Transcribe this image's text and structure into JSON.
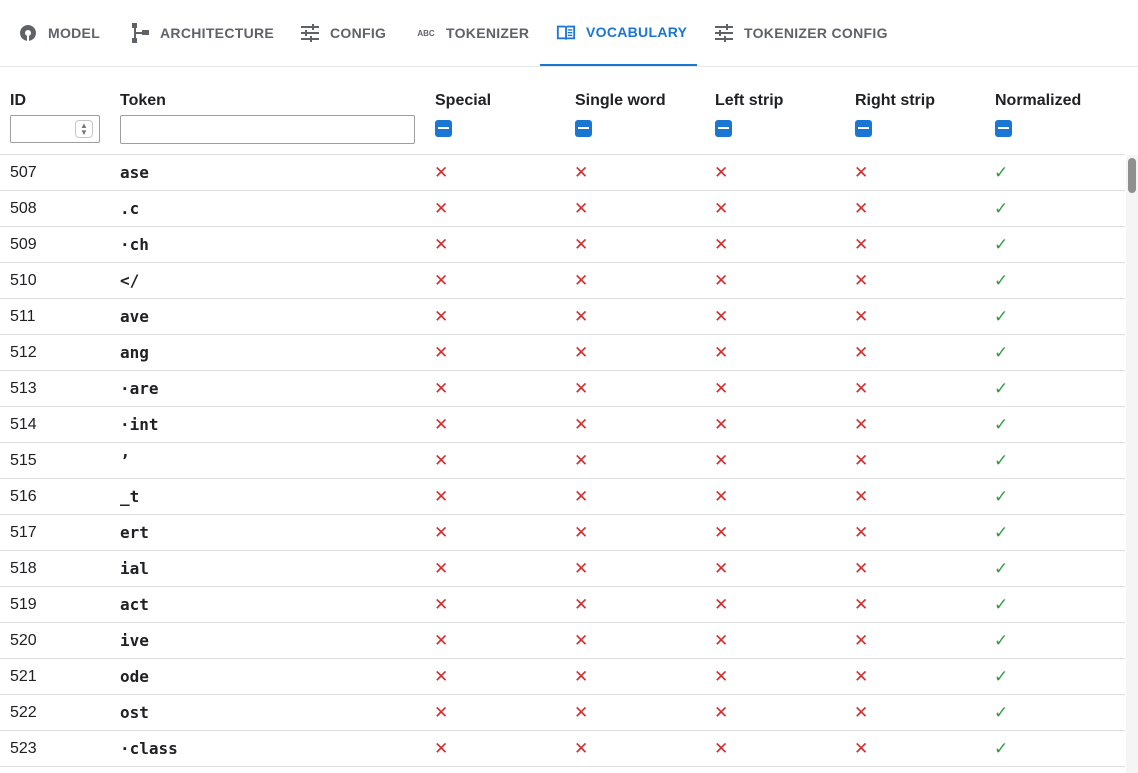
{
  "tabs": [
    {
      "label": "MODEL",
      "icon": "model-icon"
    },
    {
      "label": "ARCHITECTURE",
      "icon": "architecture-icon"
    },
    {
      "label": "CONFIG",
      "icon": "sliders-icon"
    },
    {
      "label": "TOKENIZER",
      "icon": "abc-icon"
    },
    {
      "label": "VOCABULARY",
      "icon": "book-icon",
      "active": true
    },
    {
      "label": "TOKENIZER CONFIG",
      "icon": "sliders-icon"
    }
  ],
  "columns": {
    "id": "ID",
    "token": "Token",
    "special": "Special",
    "single_word": "Single word",
    "left_strip": "Left strip",
    "right_strip": "Right strip",
    "normalized": "Normalized"
  },
  "filters": {
    "id_value": "",
    "token_value": ""
  },
  "symbols": {
    "no": "✕",
    "yes": "✓"
  },
  "colors": {
    "accent": "#1976d2",
    "no": "#d32f2f",
    "yes": "#2e9e3e"
  },
  "rows": [
    {
      "id": "507",
      "token": "ase",
      "special": "no",
      "single_word": "no",
      "left_strip": "no",
      "right_strip": "no",
      "normalized": "yes"
    },
    {
      "id": "508",
      "token": ".c",
      "special": "no",
      "single_word": "no",
      "left_strip": "no",
      "right_strip": "no",
      "normalized": "yes"
    },
    {
      "id": "509",
      "token": "·ch",
      "special": "no",
      "single_word": "no",
      "left_strip": "no",
      "right_strip": "no",
      "normalized": "yes"
    },
    {
      "id": "510",
      "token": "</",
      "special": "no",
      "single_word": "no",
      "left_strip": "no",
      "right_strip": "no",
      "normalized": "yes"
    },
    {
      "id": "511",
      "token": "ave",
      "special": "no",
      "single_word": "no",
      "left_strip": "no",
      "right_strip": "no",
      "normalized": "yes"
    },
    {
      "id": "512",
      "token": "ang",
      "special": "no",
      "single_word": "no",
      "left_strip": "no",
      "right_strip": "no",
      "normalized": "yes"
    },
    {
      "id": "513",
      "token": "·are",
      "special": "no",
      "single_word": "no",
      "left_strip": "no",
      "right_strip": "no",
      "normalized": "yes"
    },
    {
      "id": "514",
      "token": "·int",
      "special": "no",
      "single_word": "no",
      "left_strip": "no",
      "right_strip": "no",
      "normalized": "yes"
    },
    {
      "id": "515",
      "token": "’",
      "special": "no",
      "single_word": "no",
      "left_strip": "no",
      "right_strip": "no",
      "normalized": "yes"
    },
    {
      "id": "516",
      "token": "_t",
      "special": "no",
      "single_word": "no",
      "left_strip": "no",
      "right_strip": "no",
      "normalized": "yes"
    },
    {
      "id": "517",
      "token": "ert",
      "special": "no",
      "single_word": "no",
      "left_strip": "no",
      "right_strip": "no",
      "normalized": "yes"
    },
    {
      "id": "518",
      "token": "ial",
      "special": "no",
      "single_word": "no",
      "left_strip": "no",
      "right_strip": "no",
      "normalized": "yes"
    },
    {
      "id": "519",
      "token": "act",
      "special": "no",
      "single_word": "no",
      "left_strip": "no",
      "right_strip": "no",
      "normalized": "yes"
    },
    {
      "id": "520",
      "token": "ive",
      "special": "no",
      "single_word": "no",
      "left_strip": "no",
      "right_strip": "no",
      "normalized": "yes"
    },
    {
      "id": "521",
      "token": "ode",
      "special": "no",
      "single_word": "no",
      "left_strip": "no",
      "right_strip": "no",
      "normalized": "yes"
    },
    {
      "id": "522",
      "token": "ost",
      "special": "no",
      "single_word": "no",
      "left_strip": "no",
      "right_strip": "no",
      "normalized": "yes"
    },
    {
      "id": "523",
      "token": "·class",
      "special": "no",
      "single_word": "no",
      "left_strip": "no",
      "right_strip": "no",
      "normalized": "yes"
    }
  ]
}
